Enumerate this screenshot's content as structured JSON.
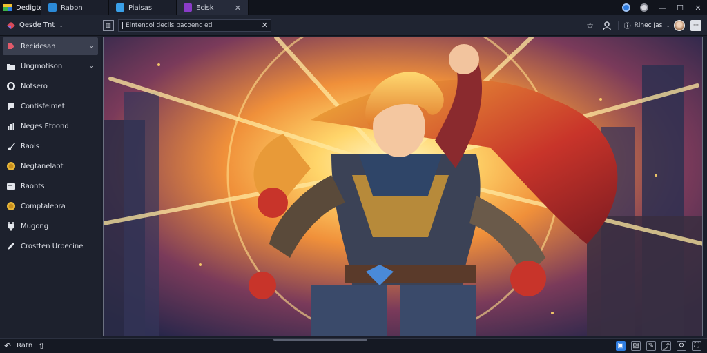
{
  "app": {
    "name": "Dedigte"
  },
  "tabs": [
    {
      "label": "Rabon",
      "icon": "document-icon",
      "color": "#2b8ad8"
    },
    {
      "label": "Piaisas",
      "icon": "gallery-icon",
      "color": "#3aa0e8"
    },
    {
      "label": "Ecisk",
      "icon": "paint-icon",
      "color": "#8a3cc8"
    }
  ],
  "toolbar": {
    "workspace_label": "Qesde Tnt",
    "address_value": "Eintencol declis bacoenc eti",
    "user_label": "Rinec Jas"
  },
  "sidebar": {
    "items": [
      {
        "label": "Recidcsah",
        "icon": "tag-icon",
        "caret": true,
        "active": true
      },
      {
        "label": "Ungmotison",
        "icon": "folder-icon",
        "caret": true
      },
      {
        "label": "Notsero",
        "icon": "shield-icon"
      },
      {
        "label": "Contisfeimet",
        "icon": "chat-icon"
      },
      {
        "label": "Neges Etoond",
        "icon": "chart-icon"
      },
      {
        "label": "Raols",
        "icon": "brush-icon"
      },
      {
        "label": "Negtanelaot",
        "icon": "coin-icon"
      },
      {
        "label": "Raonts",
        "icon": "card-icon"
      },
      {
        "label": "Comptalebra",
        "icon": "coin-icon"
      },
      {
        "label": "Mugong",
        "icon": "plug-icon"
      },
      {
        "label": "Crostten Urbecine",
        "icon": "pen-icon"
      }
    ]
  },
  "bottombar": {
    "back_label": "Ratn"
  },
  "colors": {
    "accent": "#2f7de0",
    "sidebar_active": "#3a3f4f"
  }
}
